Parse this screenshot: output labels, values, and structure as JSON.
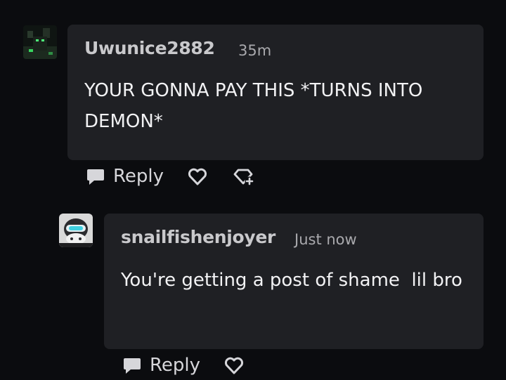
{
  "comments": [
    {
      "username": "Uwunice2882",
      "time": "35m",
      "text": "YOUR GONNA PAY THIS *TURNS INTO DEMON*",
      "reply_label": "Reply"
    },
    {
      "username": "snailfishenjoyer",
      "time": "Just now",
      "text": "You're getting a post of shame  lil bro",
      "reply_label": "Reply"
    }
  ],
  "colors": {
    "background": "#0b0c0f",
    "bubble": "#1f2024",
    "text": "#f2f2f4",
    "muted": "#a9a9ad"
  },
  "icons": [
    "chat-bubble-icon",
    "heart-icon",
    "gem-plus-icon"
  ]
}
